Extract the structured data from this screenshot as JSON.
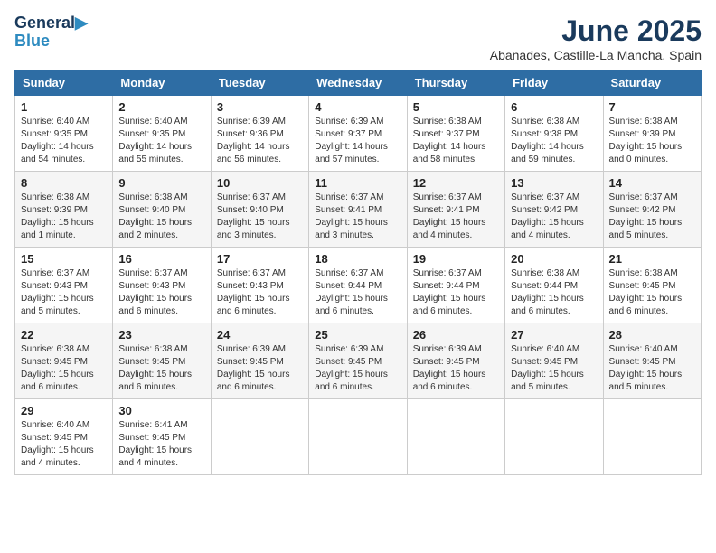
{
  "logo": {
    "line1": "General",
    "line2": "Blue"
  },
  "title": "June 2025",
  "location": "Abanades, Castille-La Mancha, Spain",
  "weekdays": [
    "Sunday",
    "Monday",
    "Tuesday",
    "Wednesday",
    "Thursday",
    "Friday",
    "Saturday"
  ],
  "weeks": [
    [
      {
        "day": "1",
        "info": "Sunrise: 6:40 AM\nSunset: 9:35 PM\nDaylight: 14 hours\nand 54 minutes."
      },
      {
        "day": "2",
        "info": "Sunrise: 6:40 AM\nSunset: 9:35 PM\nDaylight: 14 hours\nand 55 minutes."
      },
      {
        "day": "3",
        "info": "Sunrise: 6:39 AM\nSunset: 9:36 PM\nDaylight: 14 hours\nand 56 minutes."
      },
      {
        "day": "4",
        "info": "Sunrise: 6:39 AM\nSunset: 9:37 PM\nDaylight: 14 hours\nand 57 minutes."
      },
      {
        "day": "5",
        "info": "Sunrise: 6:38 AM\nSunset: 9:37 PM\nDaylight: 14 hours\nand 58 minutes."
      },
      {
        "day": "6",
        "info": "Sunrise: 6:38 AM\nSunset: 9:38 PM\nDaylight: 14 hours\nand 59 minutes."
      },
      {
        "day": "7",
        "info": "Sunrise: 6:38 AM\nSunset: 9:39 PM\nDaylight: 15 hours\nand 0 minutes."
      }
    ],
    [
      {
        "day": "8",
        "info": "Sunrise: 6:38 AM\nSunset: 9:39 PM\nDaylight: 15 hours\nand 1 minute."
      },
      {
        "day": "9",
        "info": "Sunrise: 6:38 AM\nSunset: 9:40 PM\nDaylight: 15 hours\nand 2 minutes."
      },
      {
        "day": "10",
        "info": "Sunrise: 6:37 AM\nSunset: 9:40 PM\nDaylight: 15 hours\nand 3 minutes."
      },
      {
        "day": "11",
        "info": "Sunrise: 6:37 AM\nSunset: 9:41 PM\nDaylight: 15 hours\nand 3 minutes."
      },
      {
        "day": "12",
        "info": "Sunrise: 6:37 AM\nSunset: 9:41 PM\nDaylight: 15 hours\nand 4 minutes."
      },
      {
        "day": "13",
        "info": "Sunrise: 6:37 AM\nSunset: 9:42 PM\nDaylight: 15 hours\nand 4 minutes."
      },
      {
        "day": "14",
        "info": "Sunrise: 6:37 AM\nSunset: 9:42 PM\nDaylight: 15 hours\nand 5 minutes."
      }
    ],
    [
      {
        "day": "15",
        "info": "Sunrise: 6:37 AM\nSunset: 9:43 PM\nDaylight: 15 hours\nand 5 minutes."
      },
      {
        "day": "16",
        "info": "Sunrise: 6:37 AM\nSunset: 9:43 PM\nDaylight: 15 hours\nand 6 minutes."
      },
      {
        "day": "17",
        "info": "Sunrise: 6:37 AM\nSunset: 9:43 PM\nDaylight: 15 hours\nand 6 minutes."
      },
      {
        "day": "18",
        "info": "Sunrise: 6:37 AM\nSunset: 9:44 PM\nDaylight: 15 hours\nand 6 minutes."
      },
      {
        "day": "19",
        "info": "Sunrise: 6:37 AM\nSunset: 9:44 PM\nDaylight: 15 hours\nand 6 minutes."
      },
      {
        "day": "20",
        "info": "Sunrise: 6:38 AM\nSunset: 9:44 PM\nDaylight: 15 hours\nand 6 minutes."
      },
      {
        "day": "21",
        "info": "Sunrise: 6:38 AM\nSunset: 9:45 PM\nDaylight: 15 hours\nand 6 minutes."
      }
    ],
    [
      {
        "day": "22",
        "info": "Sunrise: 6:38 AM\nSunset: 9:45 PM\nDaylight: 15 hours\nand 6 minutes."
      },
      {
        "day": "23",
        "info": "Sunrise: 6:38 AM\nSunset: 9:45 PM\nDaylight: 15 hours\nand 6 minutes."
      },
      {
        "day": "24",
        "info": "Sunrise: 6:39 AM\nSunset: 9:45 PM\nDaylight: 15 hours\nand 6 minutes."
      },
      {
        "day": "25",
        "info": "Sunrise: 6:39 AM\nSunset: 9:45 PM\nDaylight: 15 hours\nand 6 minutes."
      },
      {
        "day": "26",
        "info": "Sunrise: 6:39 AM\nSunset: 9:45 PM\nDaylight: 15 hours\nand 6 minutes."
      },
      {
        "day": "27",
        "info": "Sunrise: 6:40 AM\nSunset: 9:45 PM\nDaylight: 15 hours\nand 5 minutes."
      },
      {
        "day": "28",
        "info": "Sunrise: 6:40 AM\nSunset: 9:45 PM\nDaylight: 15 hours\nand 5 minutes."
      }
    ],
    [
      {
        "day": "29",
        "info": "Sunrise: 6:40 AM\nSunset: 9:45 PM\nDaylight: 15 hours\nand 4 minutes."
      },
      {
        "day": "30",
        "info": "Sunrise: 6:41 AM\nSunset: 9:45 PM\nDaylight: 15 hours\nand 4 minutes."
      },
      null,
      null,
      null,
      null,
      null
    ]
  ]
}
